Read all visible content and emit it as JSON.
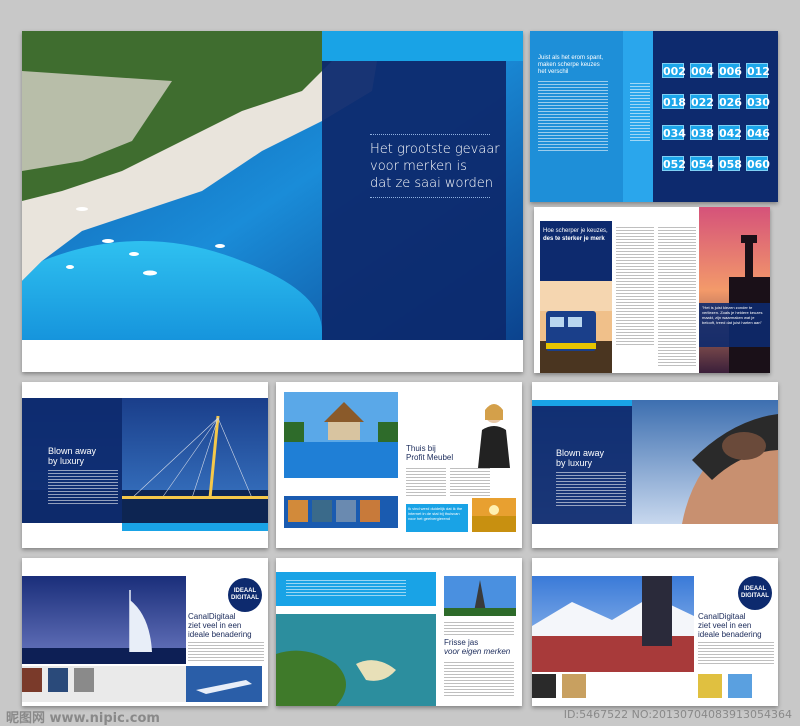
{
  "hero": {
    "headline_line1": "Het grootste gevaar",
    "headline_line2": "voor merken is",
    "headline_line3": "dat ze saai worden"
  },
  "spread2": {
    "intro_heading": "Juist als het erom spant, maken scherpe keuzes het verschil",
    "numbers": [
      "002",
      "004",
      "006",
      "012",
      "018",
      "022",
      "026",
      "030",
      "034",
      "038",
      "042",
      "046",
      "052",
      "054",
      "058",
      "060"
    ]
  },
  "spread3": {
    "headline_line1": "Hoe scherper je keuzes,",
    "headline_line2": "des te sterker je merk",
    "quote": "\"Het is juist kiezen zonder te verliezen. Zoals je heldere keuzes maakt, zijn waarmaken wat je belooft, treed dat juist harten aan\""
  },
  "spread4": {
    "headline_line1": "Blown away",
    "headline_line2": "by luxury"
  },
  "spread5": {
    "headline_line1": "Thuis bij",
    "headline_line2": "Profit Meubel",
    "caption": "Ik vind werd duidelijk dat ik the internet in de stal bij thuisvan voor het geelvergierend"
  },
  "spread6": {
    "headline_line1": "Blown away",
    "headline_line2": "by luxury"
  },
  "spread7": {
    "badge_line1": "IDEAAL",
    "badge_line2": "DIGITAAL",
    "headline_line1": "CanalDigitaal",
    "headline_line2": "ziet veel in een",
    "headline_line3": "ideale benadering"
  },
  "spread8": {
    "headline_line1": "Frisse jas",
    "headline_line2": "voor eigen merken"
  },
  "spread9": {
    "badge_line1": "IDEAAL",
    "badge_line2": "DIGITAAL",
    "headline_line1": "CanalDigitaal",
    "headline_line2": "ziet veel in een",
    "headline_line3": "ideale benadering"
  },
  "footer": {
    "left_watermark": "昵图网 www.nipic.com",
    "right_watermark": "ID:5467522 NO:20130704083913054364"
  },
  "colors": {
    "navy": "#0d2a6e",
    "cyan": "#19a3e6",
    "light_cyan": "#5cc6f2",
    "background": "#c8c8c8"
  }
}
